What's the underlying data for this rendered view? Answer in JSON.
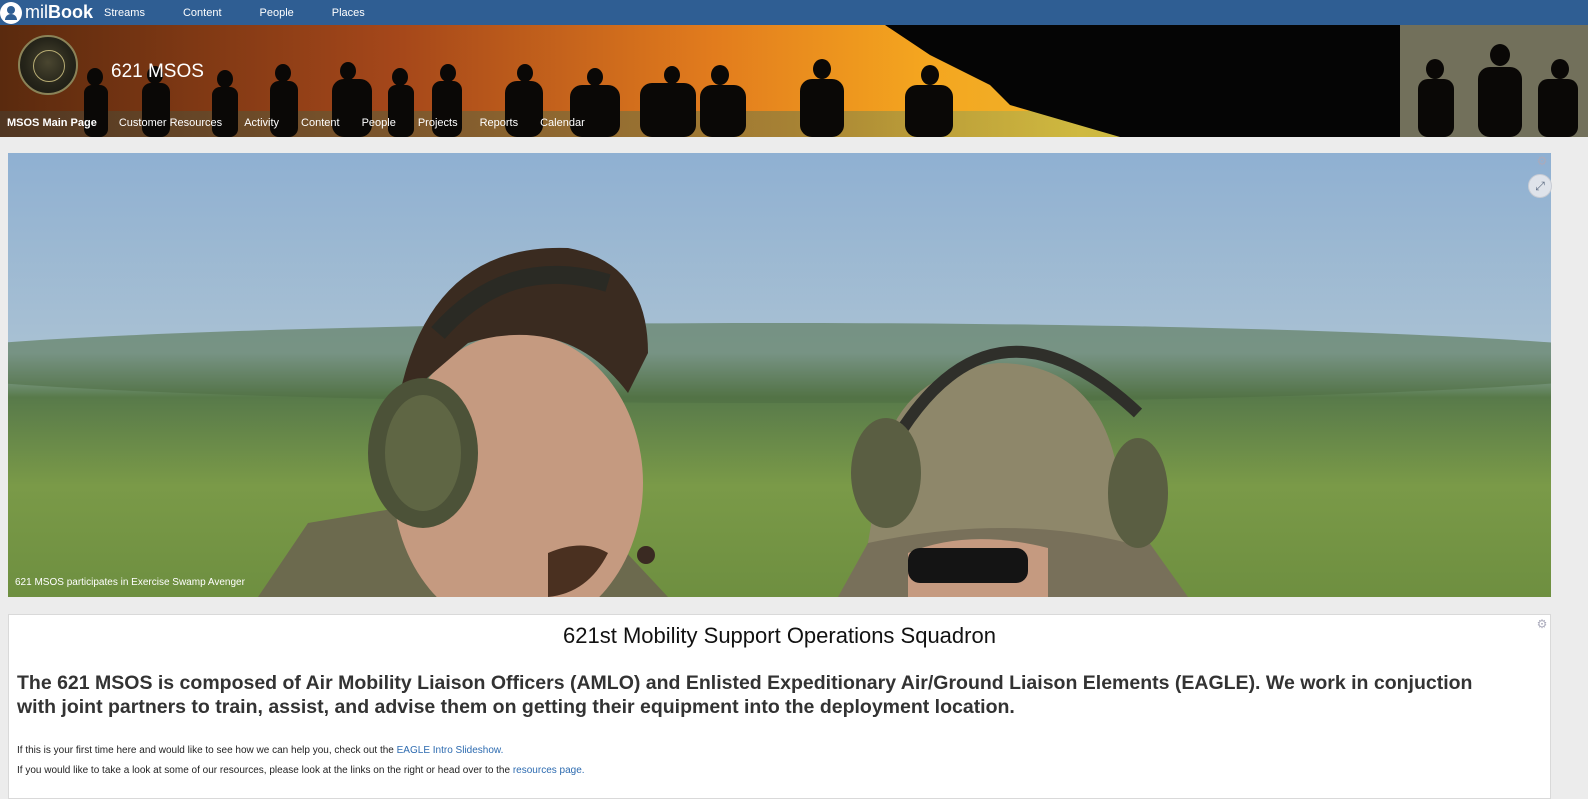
{
  "app": {
    "logo_prefix": "mil",
    "logo_bold": "Book",
    "nav": [
      "Streams",
      "Content",
      "People",
      "Places"
    ]
  },
  "place": {
    "title": "621 MSOS",
    "nav": [
      "MSOS Main Page",
      "Customer Resources",
      "Activity",
      "Content",
      "People",
      "Projects",
      "Reports",
      "Calendar"
    ],
    "active_nav": "MSOS Main Page"
  },
  "image_tile": {
    "caption": "621 MSOS participates in Exercise Swamp Avenger"
  },
  "content_tile": {
    "title": "621st Mobility Support Operations Squadron",
    "lead": "The 621 MSOS is composed of Air Mobility Liaison Officers (AMLO) and Enlisted Expeditionary Air/Ground Liaison Elements (EAGLE).  We work in conjuction with joint partners to train, assist, and advise them on getting their equipment into the deployment location.",
    "line1_text": "If this is your first time here and would like to see how we can help you, check out the ",
    "line1_link": "EAGLE Intro Slideshow.",
    "line2_text": "If you would like to take a look at some of our resources, please  look at the links on the right or head over to the ",
    "line2_link": "resources page."
  },
  "colors": {
    "topbar": "#2f5e93",
    "link": "#2d6bb0"
  },
  "icons": [
    "user-logo-icon",
    "gear-icon",
    "expand-icon",
    "unit-emblem"
  ]
}
